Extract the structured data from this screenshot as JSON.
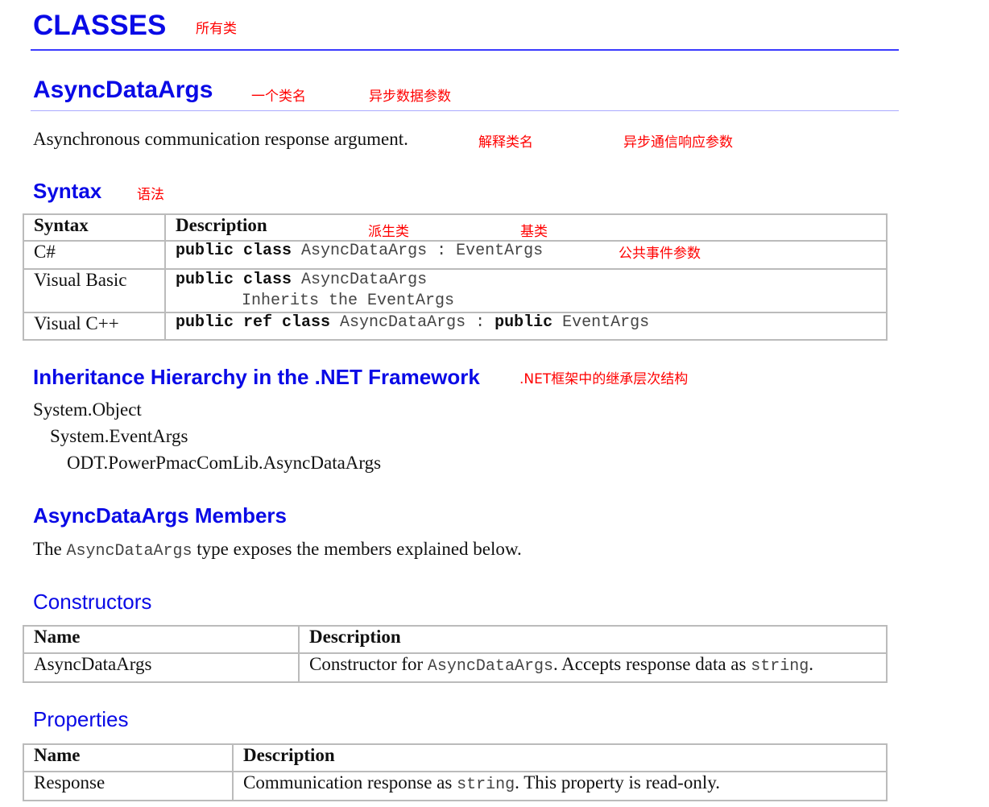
{
  "title": "CLASSES",
  "title_note": "所有类",
  "class_name": "AsyncDataArgs",
  "class_notes": [
    "一个类名",
    "异步数据参数"
  ],
  "summary": "Asynchronous communication response argument.",
  "summary_notes": [
    "解释类名",
    "异步通信响应参数"
  ],
  "syntax": {
    "heading": "Syntax",
    "heading_note": "语法",
    "headers": [
      "Syntax",
      "Description"
    ],
    "header_notes": [
      "派生类",
      "基类"
    ],
    "row_note": "公共事件参数",
    "rows": [
      {
        "lang": "C#",
        "kw": "public class",
        "name": "AsyncDataArgs",
        "sep": " : ",
        "base": "EventArgs"
      },
      {
        "lang": "Visual Basic",
        "kw": "public class",
        "name": "AsyncDataArgs",
        "line2": "Inherits the EventArgs"
      },
      {
        "lang": "Visual C++",
        "kw": "public ref class",
        "name": "AsyncDataArgs",
        "sep": " : ",
        "kw2": "public",
        "base": "EventArgs"
      }
    ]
  },
  "inheritance": {
    "heading": "Inheritance Hierarchy in the .NET Framework",
    "note": ".NET框架中的继承层次结构",
    "items": [
      "System.Object",
      "System.EventArgs",
      "ODT.PowerPmacComLib.AsyncDataArgs"
    ]
  },
  "members": {
    "heading": "AsyncDataArgs Members",
    "text_pre": "The ",
    "text_code": "AsyncDataArgs",
    "text_post": " type exposes the members explained below."
  },
  "constructors": {
    "heading": "Constructors",
    "headers": [
      "Name",
      "Description"
    ],
    "row": {
      "name": "AsyncDataArgs",
      "d1": "Constructor for ",
      "c1": "AsyncDataArgs",
      "d2": ". Accepts response data as ",
      "c2": "string",
      "d3": "."
    }
  },
  "properties": {
    "heading": "Properties",
    "headers": [
      "Name",
      "Description"
    ],
    "row": {
      "name": "Response",
      "d1": "Communication response as ",
      "c1": "string",
      "d2": ". This property is read-only."
    }
  }
}
